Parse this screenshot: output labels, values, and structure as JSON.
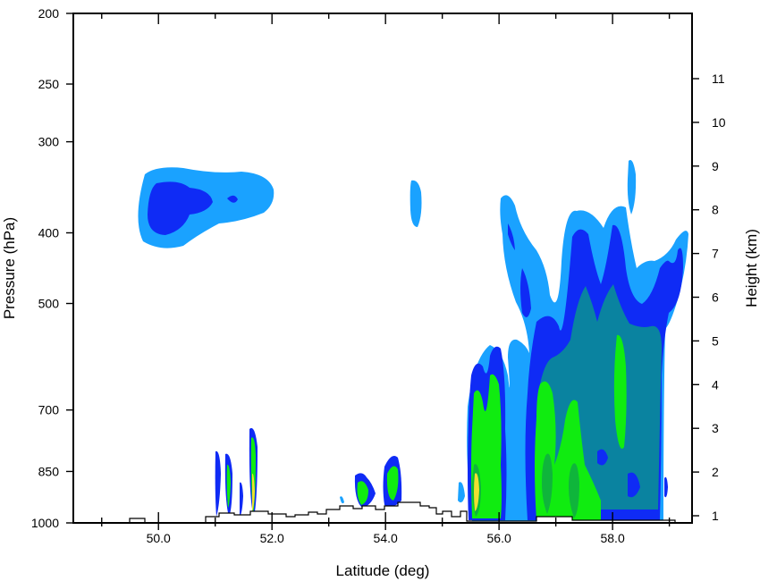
{
  "chart_data": {
    "type": "area",
    "title": "",
    "xlabel": "Latitude (deg)",
    "ylabel": "Pressure (hPa)",
    "y2label": "Height (km)",
    "xlim": [
      48.5,
      59.4
    ],
    "ylim": [
      1000,
      200
    ],
    "y_scale": "log (pressure)",
    "x_ticks": [
      {
        "v": 50.0,
        "label": "50.0"
      },
      {
        "v": 52.0,
        "label": "52.0"
      },
      {
        "v": 54.0,
        "label": "54.0"
      },
      {
        "v": 56.0,
        "label": "56.0"
      },
      {
        "v": 58.0,
        "label": "58.0"
      }
    ],
    "y_ticks": [
      {
        "v": 1000,
        "label": "1000"
      },
      {
        "v": 850,
        "label": "850"
      },
      {
        "v": 700,
        "label": "700"
      },
      {
        "v": 500,
        "label": "500"
      },
      {
        "v": 400,
        "label": "400"
      },
      {
        "v": 300,
        "label": "300"
      },
      {
        "v": 250,
        "label": "250"
      },
      {
        "v": 200,
        "label": "200"
      }
    ],
    "height_ticks": [
      {
        "v": 1,
        "label": "1"
      },
      {
        "v": 2,
        "label": "2"
      },
      {
        "v": 3,
        "label": "3"
      },
      {
        "v": 4,
        "label": "4"
      },
      {
        "v": 5,
        "label": "5"
      },
      {
        "v": 6,
        "label": "6"
      },
      {
        "v": 7,
        "label": "7"
      },
      {
        "v": 8,
        "label": "8"
      },
      {
        "v": 9,
        "label": "9"
      },
      {
        "v": 10,
        "label": "10"
      },
      {
        "v": 11,
        "label": "11"
      }
    ],
    "contour_colors": [
      "#1aa2ff",
      "#0f2bf5",
      "#0a83a0",
      "#10ec10",
      "#0fb53b",
      "#f0e030"
    ],
    "grid": false,
    "legend": "none",
    "terrain_color": "#000000"
  }
}
